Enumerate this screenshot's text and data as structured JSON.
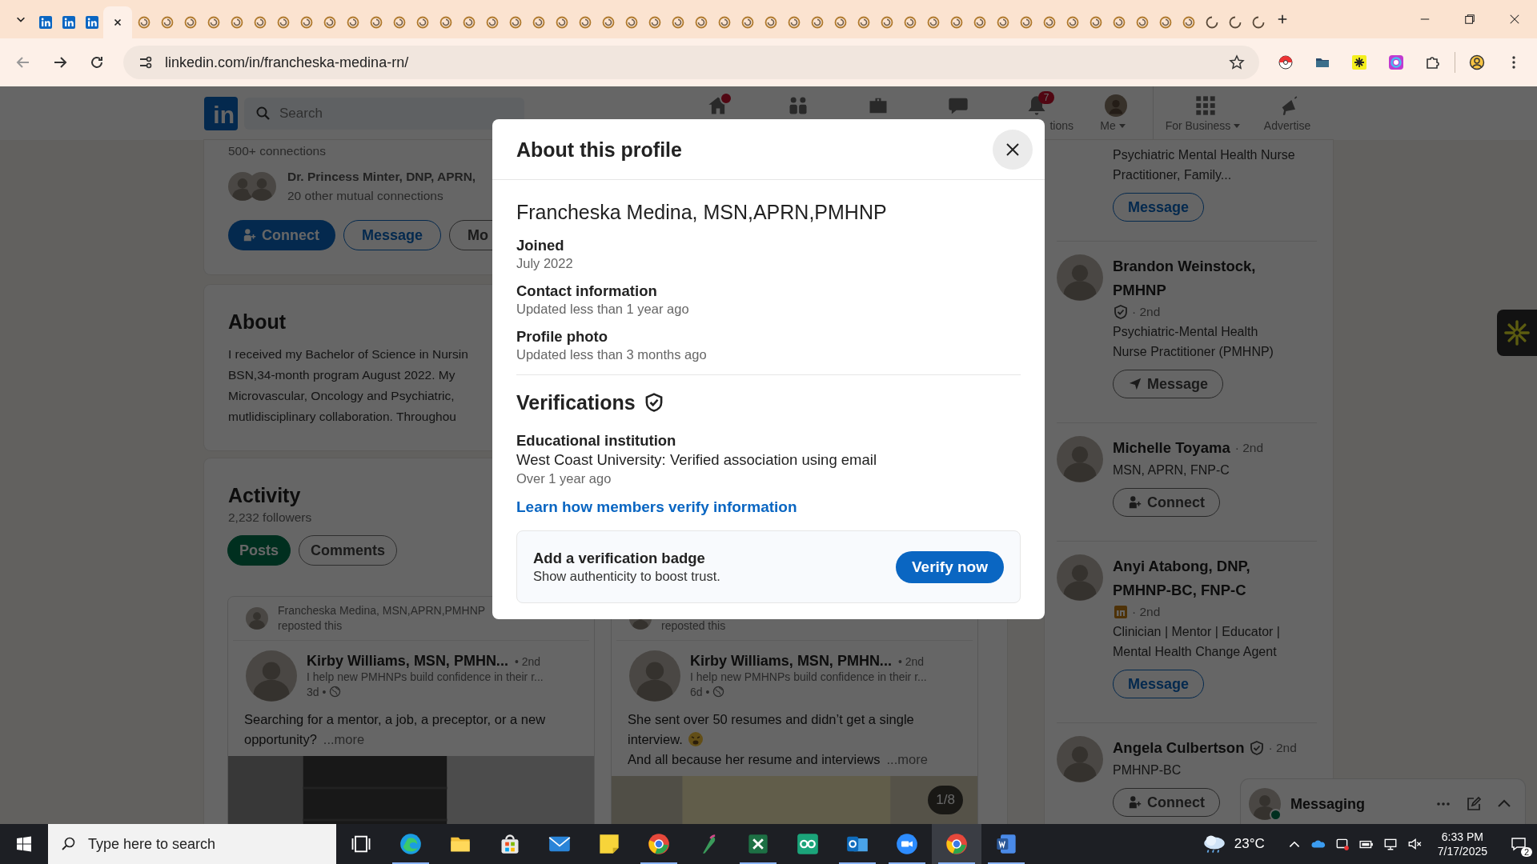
{
  "browser": {
    "tabs": [
      {
        "kind": "linkedin",
        "selected": false
      },
      {
        "kind": "linkedin",
        "selected": false
      },
      {
        "kind": "linkedin",
        "selected": false
      },
      {
        "kind": "linkedin",
        "selected": true
      },
      {
        "kind": "loading",
        "selected": false
      },
      {
        "kind": "loading",
        "selected": false
      },
      {
        "kind": "loading",
        "selected": false
      },
      {
        "kind": "loading",
        "selected": false
      },
      {
        "kind": "loading",
        "selected": false
      },
      {
        "kind": "loading",
        "selected": false
      },
      {
        "kind": "loading",
        "selected": false
      },
      {
        "kind": "loading",
        "selected": false
      },
      {
        "kind": "loading",
        "selected": false
      },
      {
        "kind": "loading",
        "selected": false
      },
      {
        "kind": "loading",
        "selected": false
      },
      {
        "kind": "loading",
        "selected": false
      },
      {
        "kind": "loading",
        "selected": false
      },
      {
        "kind": "loading",
        "selected": false
      },
      {
        "kind": "loading",
        "selected": false
      },
      {
        "kind": "loading",
        "selected": false
      },
      {
        "kind": "loading",
        "selected": false
      },
      {
        "kind": "loading",
        "selected": false
      },
      {
        "kind": "loading",
        "selected": false
      },
      {
        "kind": "loading",
        "selected": false
      },
      {
        "kind": "loading",
        "selected": false
      },
      {
        "kind": "loading",
        "selected": false
      },
      {
        "kind": "loading",
        "selected": false
      },
      {
        "kind": "loading",
        "selected": false
      },
      {
        "kind": "loading",
        "selected": false
      },
      {
        "kind": "loading",
        "selected": false
      },
      {
        "kind": "loading",
        "selected": false
      },
      {
        "kind": "loading",
        "selected": false
      },
      {
        "kind": "loading",
        "selected": false
      },
      {
        "kind": "loading",
        "selected": false
      },
      {
        "kind": "loading",
        "selected": false
      },
      {
        "kind": "loading",
        "selected": false
      },
      {
        "kind": "loading",
        "selected": false
      },
      {
        "kind": "loading",
        "selected": false
      },
      {
        "kind": "loading",
        "selected": false
      },
      {
        "kind": "loading",
        "selected": false
      },
      {
        "kind": "loading",
        "selected": false
      },
      {
        "kind": "loading",
        "selected": false
      },
      {
        "kind": "loading",
        "selected": false
      },
      {
        "kind": "loading",
        "selected": false
      },
      {
        "kind": "loading",
        "selected": false
      },
      {
        "kind": "loading",
        "selected": false
      },
      {
        "kind": "loading",
        "selected": false
      },
      {
        "kind": "loading",
        "selected": false
      },
      {
        "kind": "loading",
        "selected": false
      },
      {
        "kind": "loading",
        "selected": false
      },
      {
        "kind": "spinner",
        "selected": false
      },
      {
        "kind": "spinner",
        "selected": false
      },
      {
        "kind": "spinner",
        "selected": false
      }
    ],
    "url": "linkedin.com/in/francheska-medina-rn/",
    "extensions": [
      {
        "kind": "pokeball"
      },
      {
        "kind": "folder"
      },
      {
        "kind": "asterisk"
      },
      {
        "kind": "ring"
      },
      {
        "kind": "puzzle"
      }
    ]
  },
  "nav": {
    "logo": "in",
    "search_placeholder": "Search",
    "items": [
      {
        "kind": "home",
        "badge_dot": true
      },
      {
        "kind": "network"
      },
      {
        "kind": "jobs"
      },
      {
        "kind": "messaging"
      },
      {
        "kind": "notifications",
        "badge": "7",
        "label": "tions"
      },
      {
        "kind": "me",
        "label": "Me",
        "dropdown": true
      },
      {
        "kind": "business",
        "label": "For Business",
        "dropdown": true
      },
      {
        "kind": "advertise",
        "label": "Advertise"
      }
    ]
  },
  "profile": {
    "connections": "500+ connections",
    "mutual_names": "Dr. Princess Minter, DNP, APRN,",
    "mutual_count": "20 other mutual connections",
    "actions": [
      {
        "kind": "primary",
        "label": "Connect"
      },
      {
        "kind": "secondary",
        "label": "Message"
      },
      {
        "kind": "outline",
        "label": "Mo"
      }
    ]
  },
  "about": {
    "title": "About",
    "lines": [
      "I received my Bachelor of Science in Nursin",
      "BSN,34-month program August 2022. My",
      "Microvascular, Oncology and Psychiatric,",
      "mutlidisciplinary collaboration. Throughou"
    ]
  },
  "activity": {
    "title": "Activity",
    "followers": "2,232 followers",
    "filters": [
      {
        "label": "Posts",
        "selected": true
      },
      {
        "label": "Comments",
        "selected": false
      }
    ],
    "posts": [
      {
        "reposter": "Francheska Medina, MSN,APRN,PMHNP",
        "repost_note": "reposted this",
        "author": "Kirby Williams, MSN, PMHN...",
        "degree": "• 2nd",
        "headline": "I help new PMHNPs build confidence in their r...",
        "age": "3d •",
        "paragraphs": [
          {
            "text": "Searching for a mentor, a job, a preceptor, or a new opportunity?"
          }
        ],
        "more": "...more"
      },
      {
        "repost_note": "reposted this",
        "author": "Kirby Williams, MSN, PMHN...",
        "degree": "• 2nd",
        "headline": "I help new PMHNPs build confidence in their r...",
        "age": "6d •",
        "paragraphs": [
          {
            "text": "She sent over 50 resumes and didn’t get a single interview.",
            "emoji": true
          },
          {
            "text": "And all because her resume and interviews"
          }
        ],
        "more": "...more",
        "counter": "1/8"
      }
    ]
  },
  "suggestions": [
    {
      "headline": "Psychiatric Mental Health Nurse Practitioner, Family...",
      "action": {
        "kind": "message",
        "label": "Message"
      }
    },
    {
      "name": "Brandon Weinstock, PMHNP",
      "verified": true,
      "degree": "· 2nd",
      "headline": "Psychiatric-Mental Health Nurse Practitioner (PMHNP)",
      "action": {
        "kind": "message-send",
        "label": "Message"
      }
    },
    {
      "name": "Michelle Toyama",
      "degree": "· 2nd",
      "headline": "MSN, APRN, FNP-C",
      "action": {
        "kind": "connect",
        "label": "Connect"
      }
    },
    {
      "name": "Anyi Atabong, DNP, PMHNP-BC, FNP-C",
      "premium": true,
      "degree": "· 2nd",
      "headline": "Clinician | Mentor | Educator | Mental Health Change Agent",
      "action": {
        "kind": "message",
        "label": "Message"
      }
    },
    {
      "name": "Angela Culbertson",
      "verified": true,
      "degree": "· 2nd",
      "headline": "PMHNP-BC",
      "action": {
        "kind": "connect",
        "label": "Connect"
      }
    }
  ],
  "messaging": {
    "title": "Messaging",
    "online": true
  },
  "modal": {
    "title": "About this profile",
    "name": "Francheska Medina, MSN,APRN,PMHNP",
    "facts": [
      {
        "label": "Joined",
        "value": "July 2022"
      },
      {
        "label": "Contact information",
        "value": "Updated less than 1 year ago"
      },
      {
        "label": "Profile photo",
        "value": "Updated less than 3 months ago"
      }
    ],
    "verifications": {
      "title": "Verifications",
      "items": [
        {
          "label": "Educational institution",
          "detail": "West Coast University: Verified association using email",
          "when": "Over 1 year ago"
        }
      ],
      "link": "Learn how members verify information"
    },
    "badge_prompt": {
      "title": "Add a verification badge",
      "subtitle": "Show authenticity to boost trust.",
      "button": "Verify now"
    }
  },
  "taskbar": {
    "search_placeholder": "Type here to search",
    "apps": [
      {
        "kind": "taskview",
        "running": false,
        "selected": false
      },
      {
        "kind": "edge",
        "running": true,
        "selected": false
      },
      {
        "kind": "explorer",
        "running": false,
        "selected": false
      },
      {
        "kind": "store",
        "running": false,
        "selected": false
      },
      {
        "kind": "mail",
        "running": false,
        "selected": false
      },
      {
        "kind": "notes",
        "running": false,
        "selected": false
      },
      {
        "kind": "chrome",
        "running": true,
        "selected": false
      },
      {
        "kind": "feather",
        "running": false,
        "selected": false
      },
      {
        "kind": "excel",
        "running": true,
        "selected": false
      },
      {
        "kind": "qo",
        "running": false,
        "selected": false
      },
      {
        "kind": "outlook",
        "running": true,
        "selected": false
      },
      {
        "kind": "zoom",
        "running": true,
        "selected": false
      },
      {
        "kind": "chrome",
        "running": true,
        "selected": true
      },
      {
        "kind": "word",
        "running": true,
        "selected": false
      }
    ],
    "temperature": "23°C",
    "time": "6:33 PM",
    "date": "7/17/2025",
    "notifications": "2"
  }
}
